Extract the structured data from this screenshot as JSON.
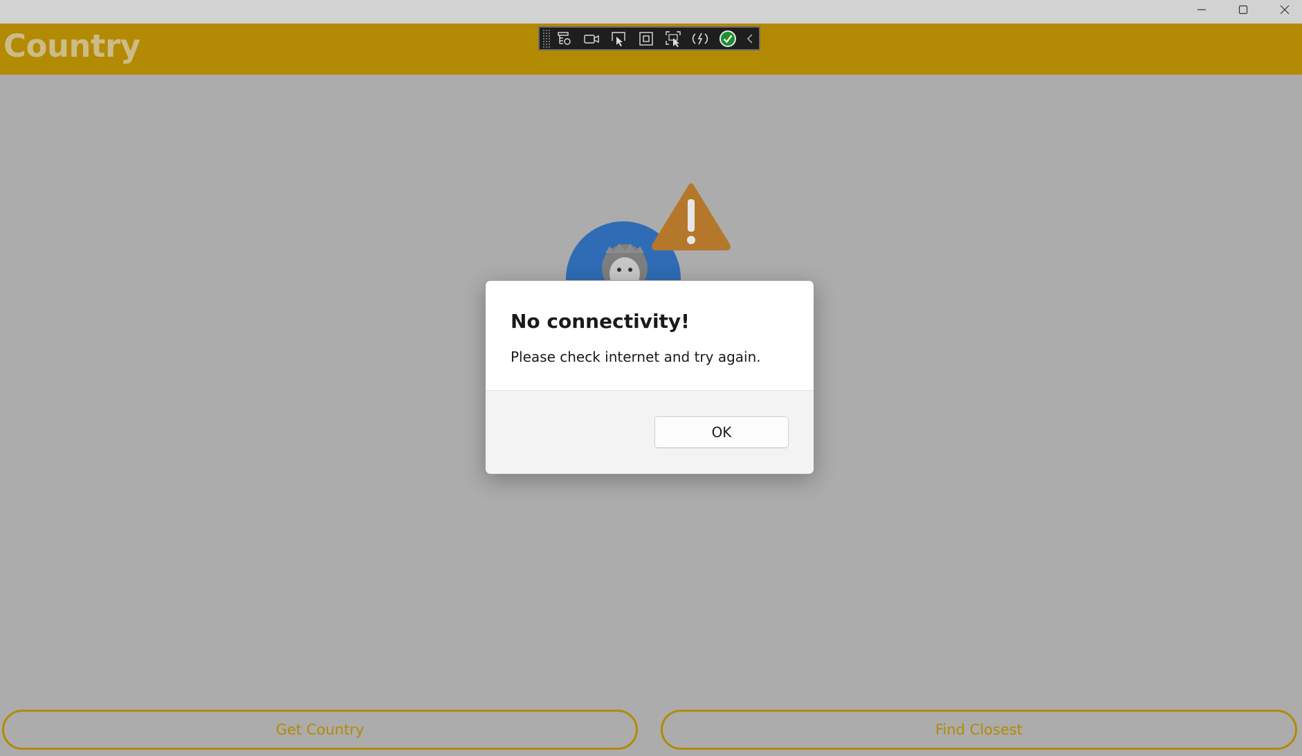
{
  "app": {
    "title": "Country"
  },
  "window_controls": {
    "minimize_icon": "minimize-icon",
    "maximize_icon": "maximize-icon",
    "close_icon": "close-icon"
  },
  "dev_toolbar": {
    "items": [
      "live-visual-tree-icon",
      "record-icon",
      "select-element-icon",
      "display-layout-adorners-icon",
      "track-focus-icon",
      "hot-reload-icon",
      "binding-failures-check-icon",
      "collapse-chevron-icon"
    ]
  },
  "dialog": {
    "title": "No connectivity!",
    "message": "Please check internet and try again.",
    "ok_label": "OK"
  },
  "buttons": {
    "get_country": "Get Country",
    "find_closest": "Find Closest"
  },
  "colors": {
    "accent": "#b38a03",
    "header_title": "#cdbb88",
    "overlay_bg": "#acacac",
    "warning": "#b5782b",
    "avatar_blue": "#2f6cb5"
  }
}
